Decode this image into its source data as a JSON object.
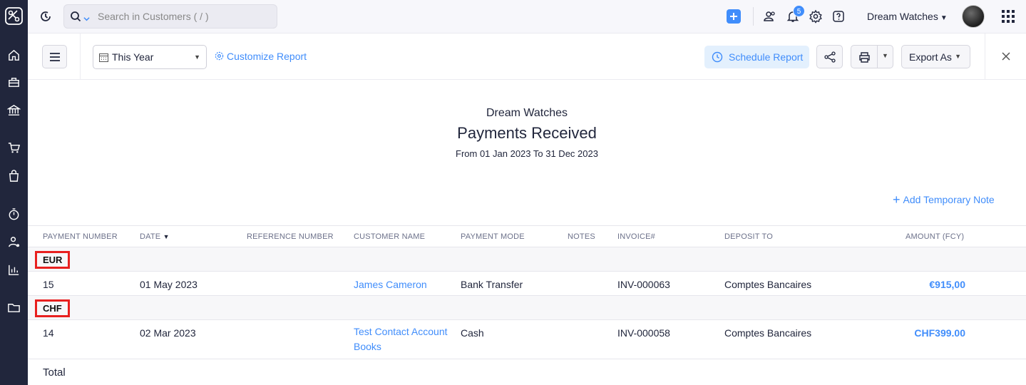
{
  "app": {
    "search_placeholder": "Search in Customers ( / )",
    "notification_count": "5",
    "org_name": "Dream Watches"
  },
  "toolbar": {
    "period": "This Year",
    "customize": "Customize Report",
    "schedule": "Schedule Report",
    "export": "Export As"
  },
  "report": {
    "org": "Dream Watches",
    "title": "Payments Received",
    "range": "From 01 Jan 2023 To 31 Dec 2023",
    "add_note": "Add Temporary Note"
  },
  "table": {
    "headers": {
      "payment_number": "PAYMENT NUMBER",
      "date": "DATE",
      "reference": "REFERENCE NUMBER",
      "customer": "CUSTOMER NAME",
      "mode": "PAYMENT MODE",
      "notes": "NOTES",
      "invoice": "INVOICE#",
      "deposit": "DEPOSIT TO",
      "amount": "AMOUNT (FCY)"
    },
    "groups": [
      {
        "currency": "EUR",
        "rows": [
          {
            "payment_number": "15",
            "date": "01 May 2023",
            "reference": "",
            "customer": "James Cameron",
            "mode": "Bank Transfer",
            "notes": "",
            "invoice": "INV-000063",
            "deposit": "Comptes Bancaires",
            "amount": "€915,00"
          }
        ]
      },
      {
        "currency": "CHF",
        "rows": [
          {
            "payment_number": "14",
            "date": "02 Mar 2023",
            "reference": "",
            "customer_line1": "Test Contact Account",
            "customer_line2": "Books",
            "mode": "Cash",
            "notes": "",
            "invoice": "INV-000058",
            "deposit": "Comptes Bancaires",
            "amount": "CHF399.00"
          }
        ]
      }
    ],
    "total_label": "Total"
  },
  "colors": {
    "accent": "#408dfb",
    "sidebar": "#21263c",
    "highlight": "#e8201f"
  }
}
